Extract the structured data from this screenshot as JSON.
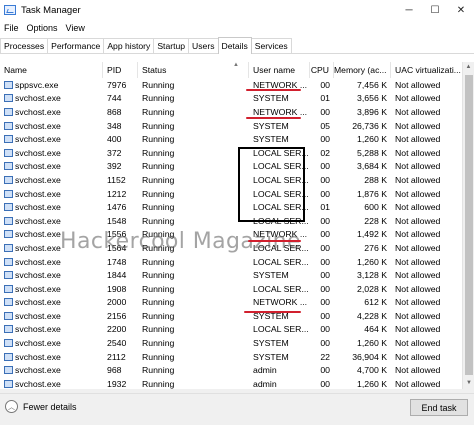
{
  "window": {
    "title": "Task Manager",
    "minimize": "─",
    "maximize": "☐",
    "close": "✕"
  },
  "menu": [
    "File",
    "Options",
    "View"
  ],
  "tabs": [
    "Processes",
    "Performance",
    "App history",
    "Startup",
    "Users",
    "Details",
    "Services"
  ],
  "active_tab": "Details",
  "columns": {
    "name": "Name",
    "pid": "PID",
    "status": "Status",
    "user": "User name",
    "cpu": "CPU",
    "memory": "Memory (ac...",
    "uac": "UAC virtualizati..."
  },
  "rows": [
    {
      "name": "sppsvc.exe",
      "pid": "7976",
      "status": "Running",
      "user": "NETWORK ...",
      "cpu": "00",
      "memory": "7,456 K",
      "uac": "Not allowed"
    },
    {
      "name": "svchost.exe",
      "pid": "744",
      "status": "Running",
      "user": "SYSTEM",
      "cpu": "01",
      "memory": "3,656 K",
      "uac": "Not allowed"
    },
    {
      "name": "svchost.exe",
      "pid": "868",
      "status": "Running",
      "user": "NETWORK ...",
      "cpu": "00",
      "memory": "3,896 K",
      "uac": "Not allowed"
    },
    {
      "name": "svchost.exe",
      "pid": "348",
      "status": "Running",
      "user": "SYSTEM",
      "cpu": "05",
      "memory": "26,736 K",
      "uac": "Not allowed"
    },
    {
      "name": "svchost.exe",
      "pid": "400",
      "status": "Running",
      "user": "SYSTEM",
      "cpu": "00",
      "memory": "1,260 K",
      "uac": "Not allowed"
    },
    {
      "name": "svchost.exe",
      "pid": "372",
      "status": "Running",
      "user": "LOCAL SER...",
      "cpu": "02",
      "memory": "5,288 K",
      "uac": "Not allowed"
    },
    {
      "name": "svchost.exe",
      "pid": "392",
      "status": "Running",
      "user": "LOCAL SER...",
      "cpu": "00",
      "memory": "3,684 K",
      "uac": "Not allowed"
    },
    {
      "name": "svchost.exe",
      "pid": "1152",
      "status": "Running",
      "user": "LOCAL SER...",
      "cpu": "00",
      "memory": "288 K",
      "uac": "Not allowed"
    },
    {
      "name": "svchost.exe",
      "pid": "1212",
      "status": "Running",
      "user": "LOCAL SER...",
      "cpu": "00",
      "memory": "1,876 K",
      "uac": "Not allowed"
    },
    {
      "name": "svchost.exe",
      "pid": "1476",
      "status": "Running",
      "user": "LOCAL SER...",
      "cpu": "01",
      "memory": "600 K",
      "uac": "Not allowed"
    },
    {
      "name": "svchost.exe",
      "pid": "1548",
      "status": "Running",
      "user": "LOCAL SER...",
      "cpu": "00",
      "memory": "228 K",
      "uac": "Not allowed"
    },
    {
      "name": "svchost.exe",
      "pid": "1556",
      "status": "Running",
      "user": "NETWORK ...",
      "cpu": "00",
      "memory": "1,492 K",
      "uac": "Not allowed"
    },
    {
      "name": "svchost.exe",
      "pid": "1564",
      "status": "Running",
      "user": "LOCAL SER...",
      "cpu": "00",
      "memory": "276 K",
      "uac": "Not allowed"
    },
    {
      "name": "svchost.exe",
      "pid": "1748",
      "status": "Running",
      "user": "LOCAL SER...",
      "cpu": "00",
      "memory": "1,260 K",
      "uac": "Not allowed"
    },
    {
      "name": "svchost.exe",
      "pid": "1844",
      "status": "Running",
      "user": "SYSTEM",
      "cpu": "00",
      "memory": "3,128 K",
      "uac": "Not allowed"
    },
    {
      "name": "svchost.exe",
      "pid": "1908",
      "status": "Running",
      "user": "LOCAL SER...",
      "cpu": "00",
      "memory": "2,028 K",
      "uac": "Not allowed"
    },
    {
      "name": "svchost.exe",
      "pid": "2000",
      "status": "Running",
      "user": "NETWORK ...",
      "cpu": "00",
      "memory": "612 K",
      "uac": "Not allowed"
    },
    {
      "name": "svchost.exe",
      "pid": "2156",
      "status": "Running",
      "user": "SYSTEM",
      "cpu": "00",
      "memory": "4,228 K",
      "uac": "Not allowed"
    },
    {
      "name": "svchost.exe",
      "pid": "2200",
      "status": "Running",
      "user": "LOCAL SER...",
      "cpu": "00",
      "memory": "464 K",
      "uac": "Not allowed"
    },
    {
      "name": "svchost.exe",
      "pid": "2540",
      "status": "Running",
      "user": "SYSTEM",
      "cpu": "00",
      "memory": "1,260 K",
      "uac": "Not allowed"
    },
    {
      "name": "svchost.exe",
      "pid": "2112",
      "status": "Running",
      "user": "SYSTEM",
      "cpu": "22",
      "memory": "36,904 K",
      "uac": "Not allowed"
    },
    {
      "name": "svchost.exe",
      "pid": "968",
      "status": "Running",
      "user": "admin",
      "cpu": "00",
      "memory": "4,700 K",
      "uac": "Not allowed"
    },
    {
      "name": "svchost.exe",
      "pid": "1932",
      "status": "Running",
      "user": "admin",
      "cpu": "00",
      "memory": "1,260 K",
      "uac": "Not allowed"
    }
  ],
  "footer": {
    "fewer_details": "Fewer details",
    "end_task": "End task"
  },
  "watermark": "Hackercool Magazine",
  "colors": {
    "annotation_underline": "#d1202e",
    "annotation_box": "#000000",
    "window_bg": "#ffffff",
    "footer_bg": "#f0f0f0"
  }
}
